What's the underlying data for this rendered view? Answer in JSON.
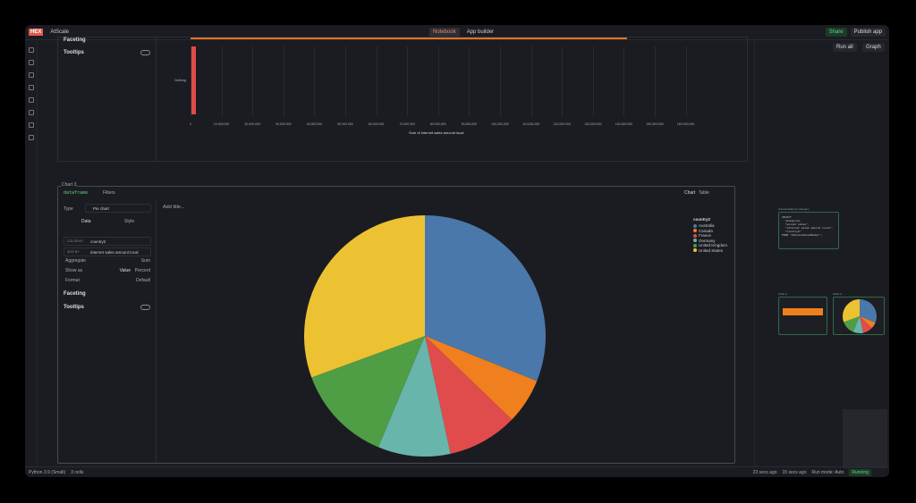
{
  "topbar": {
    "logo": "HEX",
    "project": "AtScale",
    "tabs": [
      "Notebook",
      "App builder"
    ],
    "share": "Share",
    "publish": "Publish app"
  },
  "toolbar": {
    "run_all": "Run all",
    "graph": "Graph"
  },
  "cell1": {
    "faceting": "Faceting",
    "tooltips": "Tooltips",
    "y_category": "Clothing",
    "x_ticks": [
      "0",
      "10,000,000",
      "20,000,000",
      "30,000,000",
      "40,000,000",
      "50,000,000",
      "60,000,000",
      "70,000,000",
      "80,000,000",
      "90,000,000",
      "100,000,000",
      "110,000,000",
      "120,000,000",
      "130,000,000",
      "140,000,000",
      "150,000,000",
      "160,000,000"
    ],
    "x_label": "Sum of internet sales amount local"
  },
  "cell2": {
    "name": "Chart 3",
    "source": "dataframe",
    "filters": "Filters",
    "view_chart": "Chart",
    "view_table": "Table",
    "type_label": "Type",
    "type_value": "Pie chart",
    "tab_data": "Data",
    "tab_style": "Style",
    "color_by_label": "COLOR BY",
    "color_by": "country2",
    "size_by_label": "SIZE BY",
    "size_by": "internet sales amount local",
    "aggregate_label": "Aggregate",
    "aggregate": "Sum",
    "show_as_label": "Show as",
    "show_value": "Value",
    "show_percent": "Percent",
    "format_label": "Format",
    "format": "Default",
    "faceting": "Faceting",
    "tooltips": "Tooltips",
    "add_title": "Add title..."
  },
  "chart_data": {
    "type": "pie",
    "legend_title": "country2",
    "legend_position": "top-right",
    "categories": [
      "Australia",
      "Canada",
      "France",
      "Germany",
      "United Kingdom",
      "United States"
    ],
    "values": [
      31.1,
      6.1,
      9.4,
      9.7,
      13.1,
      30.6
    ],
    "colors": [
      "#4a78aa",
      "#f07f1e",
      "#e04b4b",
      "#68b5ac",
      "#4f9e45",
      "#ecc232"
    ]
  },
  "graph": {
    "sql_title": "Annual Sales by Category",
    "sql": "SELECT\n  category2,\n  \"annual sales\",\n  \"internet sales amount local\",\n  \"country2\"\nFROM \"AtScaleSalesModel\";",
    "chart2": "Chart 2",
    "chart3": "Chart 3"
  },
  "status": {
    "kernel": "Python 3.9 (Small)",
    "cells": "3 cells",
    "edited": "23 secs ago",
    "run": "15 secs ago",
    "run_mode": "Run mode: Auto",
    "state": "Running"
  }
}
